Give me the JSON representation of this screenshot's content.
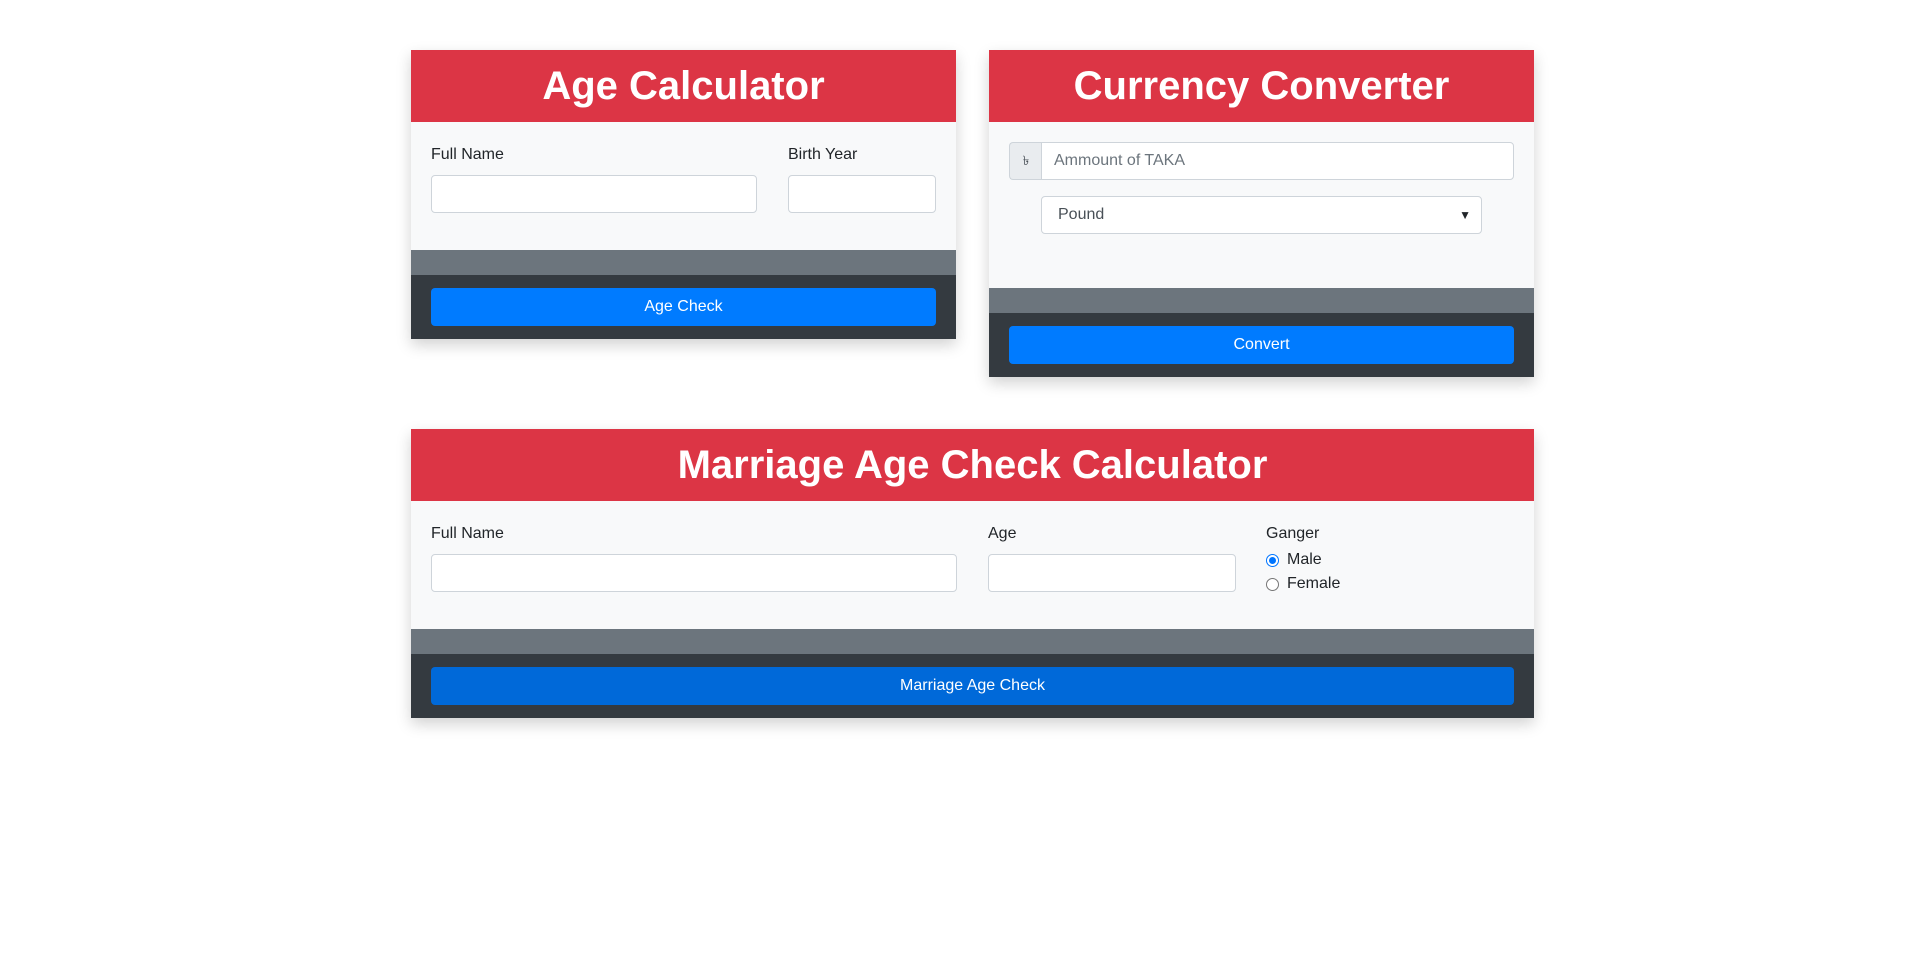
{
  "age_calculator": {
    "title": "Age Calculator",
    "full_name_label": "Full Name",
    "full_name_value": "",
    "birth_year_label": "Birth Year",
    "birth_year_value": "",
    "button_label": "Age Check"
  },
  "currency_converter": {
    "title": "Currency Converter",
    "currency_symbol": "৳",
    "amount_placeholder": "Ammount of TAKA",
    "amount_value": "",
    "selected_currency": "Pound",
    "button_label": "Convert"
  },
  "marriage_calculator": {
    "title": "Marriage Age Check Calculator",
    "full_name_label": "Full Name",
    "full_name_value": "",
    "age_label": "Age",
    "age_value": "",
    "gender_label": "Ganger",
    "gender_options": [
      "Male",
      "Female"
    ],
    "gender_selected": "Male",
    "button_label": "Marriage Age Check"
  },
  "colors": {
    "header_red": "#dc3545",
    "button_blue": "#007bff",
    "footer_dark": "#343a40",
    "strip_gray": "#6c757d"
  }
}
